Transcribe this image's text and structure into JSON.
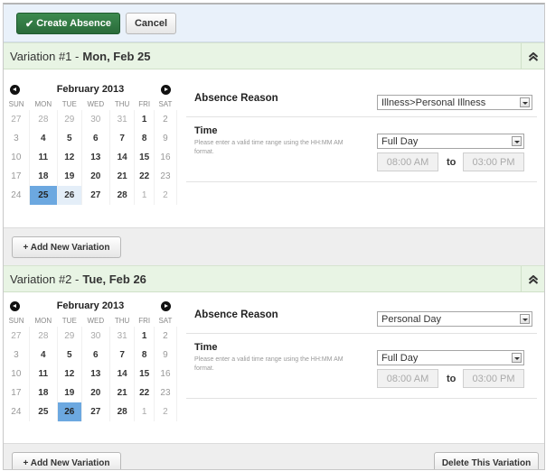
{
  "toolbar": {
    "create_label": "Create Absence",
    "cancel_label": "Cancel"
  },
  "weekdays": [
    "SUN",
    "MON",
    "TUE",
    "WED",
    "THU",
    "FRI",
    "SAT"
  ],
  "variations": [
    {
      "title": "Variation #1 - ",
      "date": "Mon, Feb 25",
      "month_label": "February 2013",
      "weeks": [
        [
          "27",
          "28",
          "29",
          "30",
          "31",
          "1",
          "2"
        ],
        [
          "3",
          "4",
          "5",
          "6",
          "7",
          "8",
          "9"
        ],
        [
          "10",
          "11",
          "12",
          "13",
          "14",
          "15",
          "16"
        ],
        [
          "17",
          "18",
          "19",
          "20",
          "21",
          "22",
          "23"
        ],
        [
          "24",
          "25",
          "26",
          "27",
          "28",
          "1",
          "2"
        ]
      ],
      "selected_day": "25",
      "absence_reason_label": "Absence Reason",
      "absence_reason_value": "Illness>Personal Illness",
      "time_label": "Time",
      "time_hint": "Please enter a valid time range using the HH:MM AM format.",
      "time_select": "Full Day",
      "start_time": "08:00 AM",
      "to_label": "to",
      "end_time": "03:00 PM"
    },
    {
      "title": "Variation #2 - ",
      "date": "Tue, Feb 26",
      "month_label": "February 2013",
      "weeks": [
        [
          "27",
          "28",
          "29",
          "30",
          "31",
          "1",
          "2"
        ],
        [
          "3",
          "4",
          "5",
          "6",
          "7",
          "8",
          "9"
        ],
        [
          "10",
          "11",
          "12",
          "13",
          "14",
          "15",
          "16"
        ],
        [
          "17",
          "18",
          "19",
          "20",
          "21",
          "22",
          "23"
        ],
        [
          "24",
          "25",
          "26",
          "27",
          "28",
          "1",
          "2"
        ]
      ],
      "selected_day": "26",
      "absence_reason_label": "Absence Reason",
      "absence_reason_value": "Personal Day",
      "time_label": "Time",
      "time_hint": "Please enter a valid time range using the HH:MM AM format.",
      "time_select": "Full Day",
      "start_time": "08:00 AM",
      "to_label": "to",
      "end_time": "03:00 PM"
    }
  ],
  "add_variation_label": "+ Add New Variation",
  "delete_variation_label": "Delete This Variation",
  "colors": {
    "accent_green": "#2f7a43",
    "header_green": "#e8f4e4",
    "selected_day": "#6ca8e0",
    "toolbar_bg": "#e9f1fa"
  },
  "icons": {
    "create": "check-icon",
    "collapse": "double-chevron-up-icon",
    "prev": "prev-month-icon",
    "next": "next-month-icon",
    "dropdown": "dropdown-caret-icon"
  }
}
